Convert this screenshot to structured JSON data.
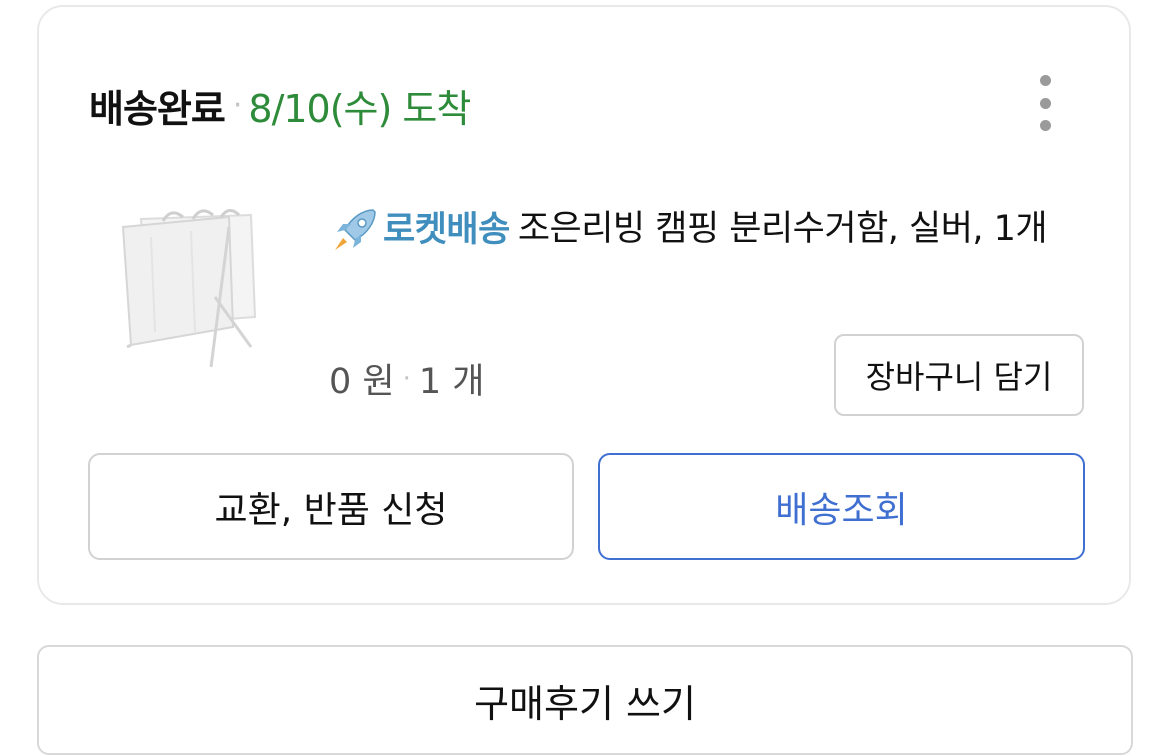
{
  "order": {
    "status": "배송완료",
    "separator": "·",
    "arrival": "8/10(수) 도착",
    "more_menu_icon": "more-vertical-icon",
    "item": {
      "delivery_badge_icon": "rocket-icon",
      "delivery_badge": "로켓배송",
      "title": "조은리빙 캠핑 분리수거함, 실버, 1개",
      "price": "0 원",
      "quantity": "1 개",
      "add_to_cart_label": "장바구니 담기"
    },
    "actions": {
      "exchange_return_label": "교환, 반품 신청",
      "track_delivery_label": "배송조회"
    }
  },
  "review": {
    "write_review_label": "구매후기 쓰기"
  },
  "colors": {
    "arrival_green": "#2e8b3a",
    "rocket_blue": "#3f8ebd",
    "track_blue": "#3f6fd1",
    "border_gray": "#d2d2d2"
  }
}
